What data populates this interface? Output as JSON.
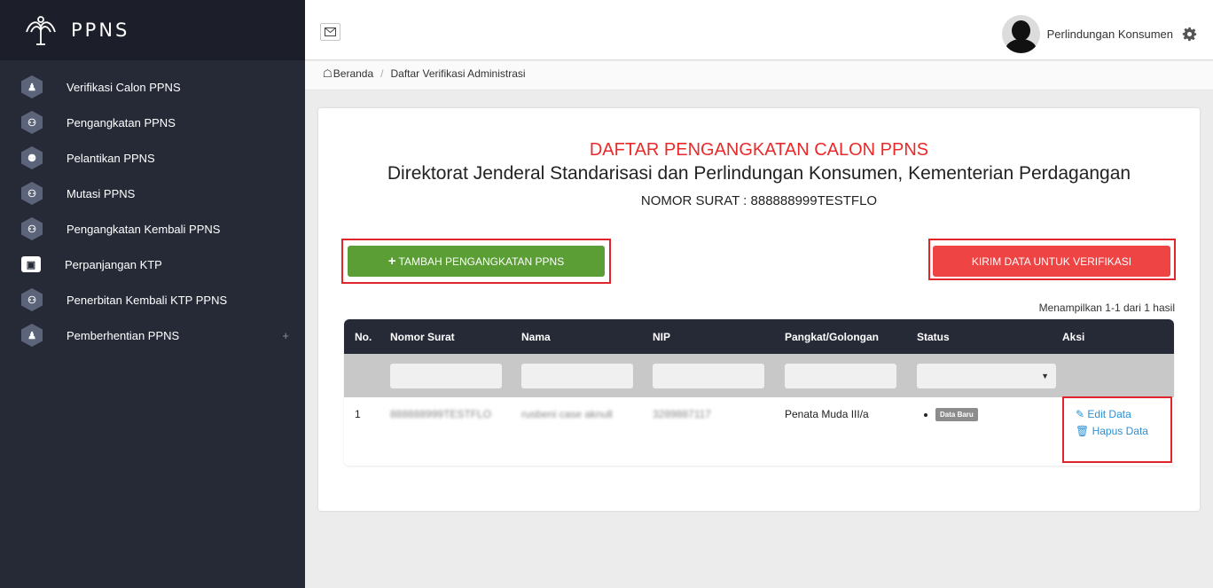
{
  "sidebar": {
    "brand": "PPNS",
    "items": [
      {
        "label": "Verifikasi Calon PPNS",
        "icon": "user-check-icon"
      },
      {
        "label": "Pengangkatan PPNS",
        "icon": "users-icon"
      },
      {
        "label": "Pelantikan PPNS",
        "icon": "group-icon"
      },
      {
        "label": "Mutasi PPNS",
        "icon": "users-icon"
      },
      {
        "label": "Pengangkatan Kembali PPNS",
        "icon": "users-icon"
      },
      {
        "label": "Perpanjangan KTP",
        "icon": "id-card-icon"
      },
      {
        "label": "Penerbitan Kembali KTP PPNS",
        "icon": "users-icon"
      },
      {
        "label": "Pemberhentian PPNS",
        "icon": "user-check-icon",
        "expand": "+"
      }
    ]
  },
  "topbar": {
    "user_name": "Perlindungan Konsumen"
  },
  "breadcrumb": {
    "home": "Beranda",
    "separator": "/",
    "current": "Daftar Verifikasi Administrasi"
  },
  "main": {
    "title": "DAFTAR PENGANGKATAN CALON PPNS",
    "subtitle": "Direktorat Jenderal Standarisasi dan Perlindungan Konsumen, Kementerian Perdagangan",
    "nomor_surat": "NOMOR SURAT : 888888999TESTFLO",
    "add_button": "TAMBAH PENGANGKATAN PPNS",
    "add_button_plus": "+",
    "send_button": "KIRIM DATA UNTUK VERIFIKASI",
    "summary": "Menampilkan 1-1 dari 1 hasil"
  },
  "table": {
    "headers": [
      "No.",
      "Nomor Surat",
      "Nama",
      "NIP",
      "Pangkat/Golongan",
      "Status",
      "Aksi"
    ],
    "rows": [
      {
        "no": "1",
        "nomor_surat": "888888999TESTFLO",
        "nama": "rusbeni case aknull",
        "nip": "3289887117",
        "pangkat": "Penata Muda III/a",
        "status": "Data Baru",
        "edit": "Edit Data",
        "delete": "Hapus Data"
      }
    ]
  },
  "colors": {
    "sidebar_bg": "#262a37",
    "title_red": "#ea2a2a",
    "add_green": "#5a9e35",
    "send_red": "#ee4444",
    "highlight_red": "#e0252b",
    "link_blue": "#2a91d6"
  }
}
